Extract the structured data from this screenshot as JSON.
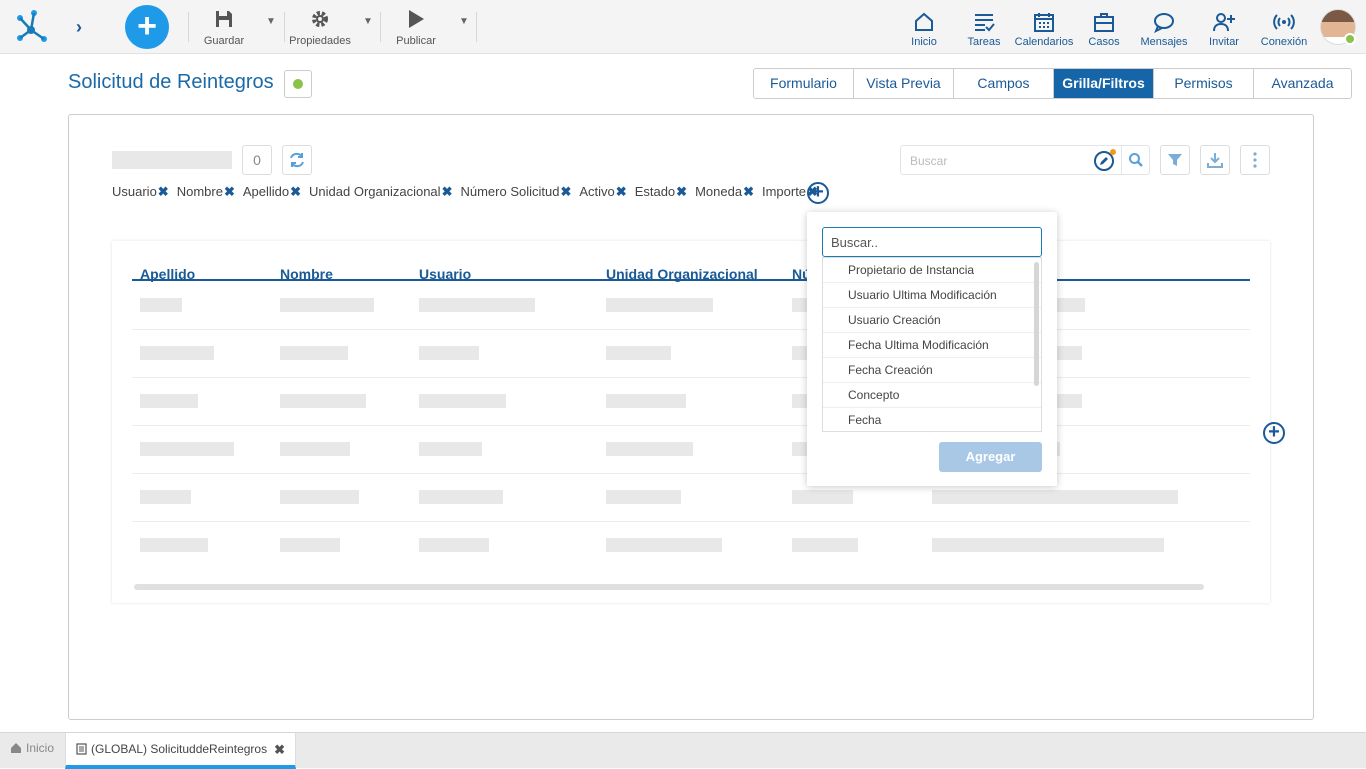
{
  "toolbar": {
    "guardar": "Guardar",
    "propiedades": "Propiedades",
    "publicar": "Publicar"
  },
  "nav": [
    {
      "label": "Inicio",
      "icon": "home-icon"
    },
    {
      "label": "Tareas",
      "icon": "tasks-icon"
    },
    {
      "label": "Calendarios",
      "icon": "calendar-icon"
    },
    {
      "label": "Casos",
      "icon": "briefcase-icon"
    },
    {
      "label": "Mensajes",
      "icon": "chat-icon"
    },
    {
      "label": "Invitar",
      "icon": "invite-user-icon"
    },
    {
      "label": "Conexión",
      "icon": "broadcast-icon"
    }
  ],
  "page": {
    "title": "Solicitud de Reintegros",
    "status_color": "#8bc34a"
  },
  "tabs": [
    "Formulario",
    "Vista Previa",
    "Campos",
    "Grilla/Filtros",
    "Permisos",
    "Avanzada"
  ],
  "active_tab": "Grilla/Filtros",
  "grid_toolbar": {
    "count": "0",
    "search_placeholder": "Buscar"
  },
  "filter_chips": [
    "Usuario",
    "Nombre",
    "Apellido",
    "Unidad Organizacional",
    "Número Solicitud",
    "Activo",
    "Estado",
    "Moneda",
    "Importe"
  ],
  "columns": [
    "Apellido",
    "Nombre",
    "Usuario",
    "Unidad Organizacional",
    "Nú"
  ],
  "popup": {
    "search_placeholder": "Buscar..",
    "items": [
      "Propietario de Instancia",
      "Usuario Ultima Modificación",
      "Usuario Creación",
      "Fecha Ultima Modificación",
      "Fecha Creación",
      "Concepto",
      "Fecha"
    ],
    "button": "Agregar"
  },
  "footer": {
    "home": "Inicio",
    "tab": "(GLOBAL) SolicituddeReintegros"
  },
  "colors": {
    "accent": "#1a5a96",
    "primary_button": "#1e9ae8",
    "active_tab": "#1565a8"
  }
}
